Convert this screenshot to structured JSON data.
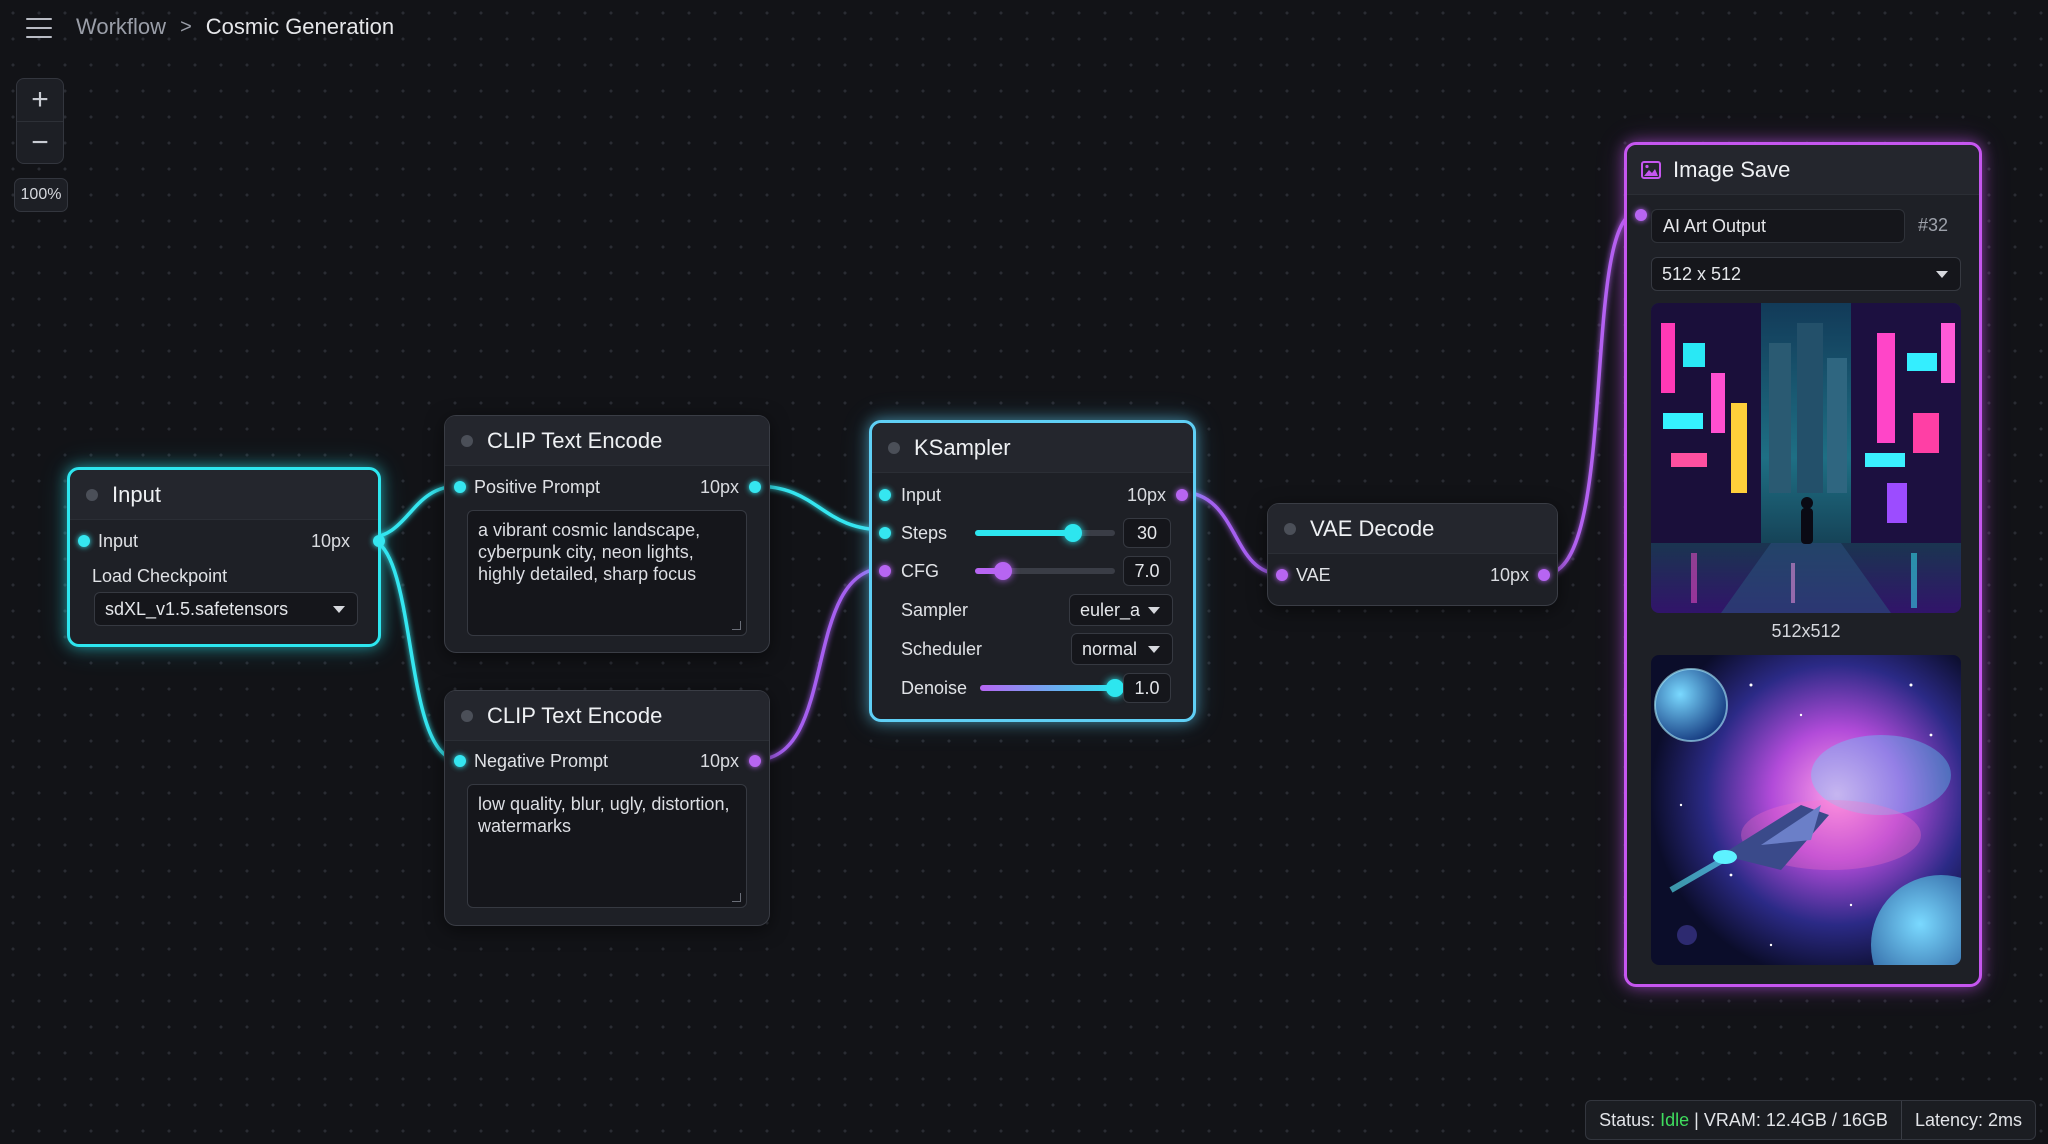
{
  "breadcrumb": {
    "root": "Workflow",
    "separator": ">",
    "current": "Cosmic Generation"
  },
  "zoom": {
    "plus": "+",
    "minus": "−",
    "level": "100%"
  },
  "nodes": {
    "input": {
      "title": "Input",
      "port_label": "Input",
      "port_value": "10px",
      "checkpoint_label": "Load Checkpoint",
      "checkpoint_value": "sdXL_v1.5.safetensors"
    },
    "clip_positive": {
      "title": "CLIP Text Encode",
      "port_label": "Positive Prompt",
      "port_value": "10px",
      "text": "a vibrant cosmic landscape, cyberpunk city, neon lights, highly detailed, sharp focus"
    },
    "clip_negative": {
      "title": "CLIP Text Encode",
      "port_label": "Negative Prompt",
      "port_value": "10px",
      "text": "low quality, blur, ugly, distortion, watermarks"
    },
    "ksampler": {
      "title": "KSampler",
      "input_label": "Input",
      "input_value": "10px",
      "steps_label": "Steps",
      "steps_value": "30",
      "steps_level": 0.7,
      "cfg_label": "CFG",
      "cfg_value": "7.0",
      "cfg_level": 0.2,
      "sampler_label": "Sampler",
      "sampler_value": "euler_a",
      "scheduler_label": "Scheduler",
      "scheduler_value": "normal",
      "denoise_label": "Denoise",
      "denoise_value": "1.0",
      "denoise_level": 1.0
    },
    "vae_decode": {
      "title": "VAE Decode",
      "port_label": "VAE",
      "port_value": "10px"
    },
    "image_save": {
      "title": "Image Save",
      "filename": "AI Art Output",
      "counter": "#32",
      "size_option": "512 x 512",
      "image1_caption": "512x512"
    }
  },
  "status": {
    "label": "Status:",
    "state": "Idle",
    "vram": "| VRAM: 12.4GB / 16GB",
    "latency": "Latency: 2ms"
  },
  "colors": {
    "cyan": "#2de6ef",
    "purple": "#b765f2",
    "magenta": "#c656f0",
    "idle": "#3fdc5e",
    "background": "#121317"
  }
}
